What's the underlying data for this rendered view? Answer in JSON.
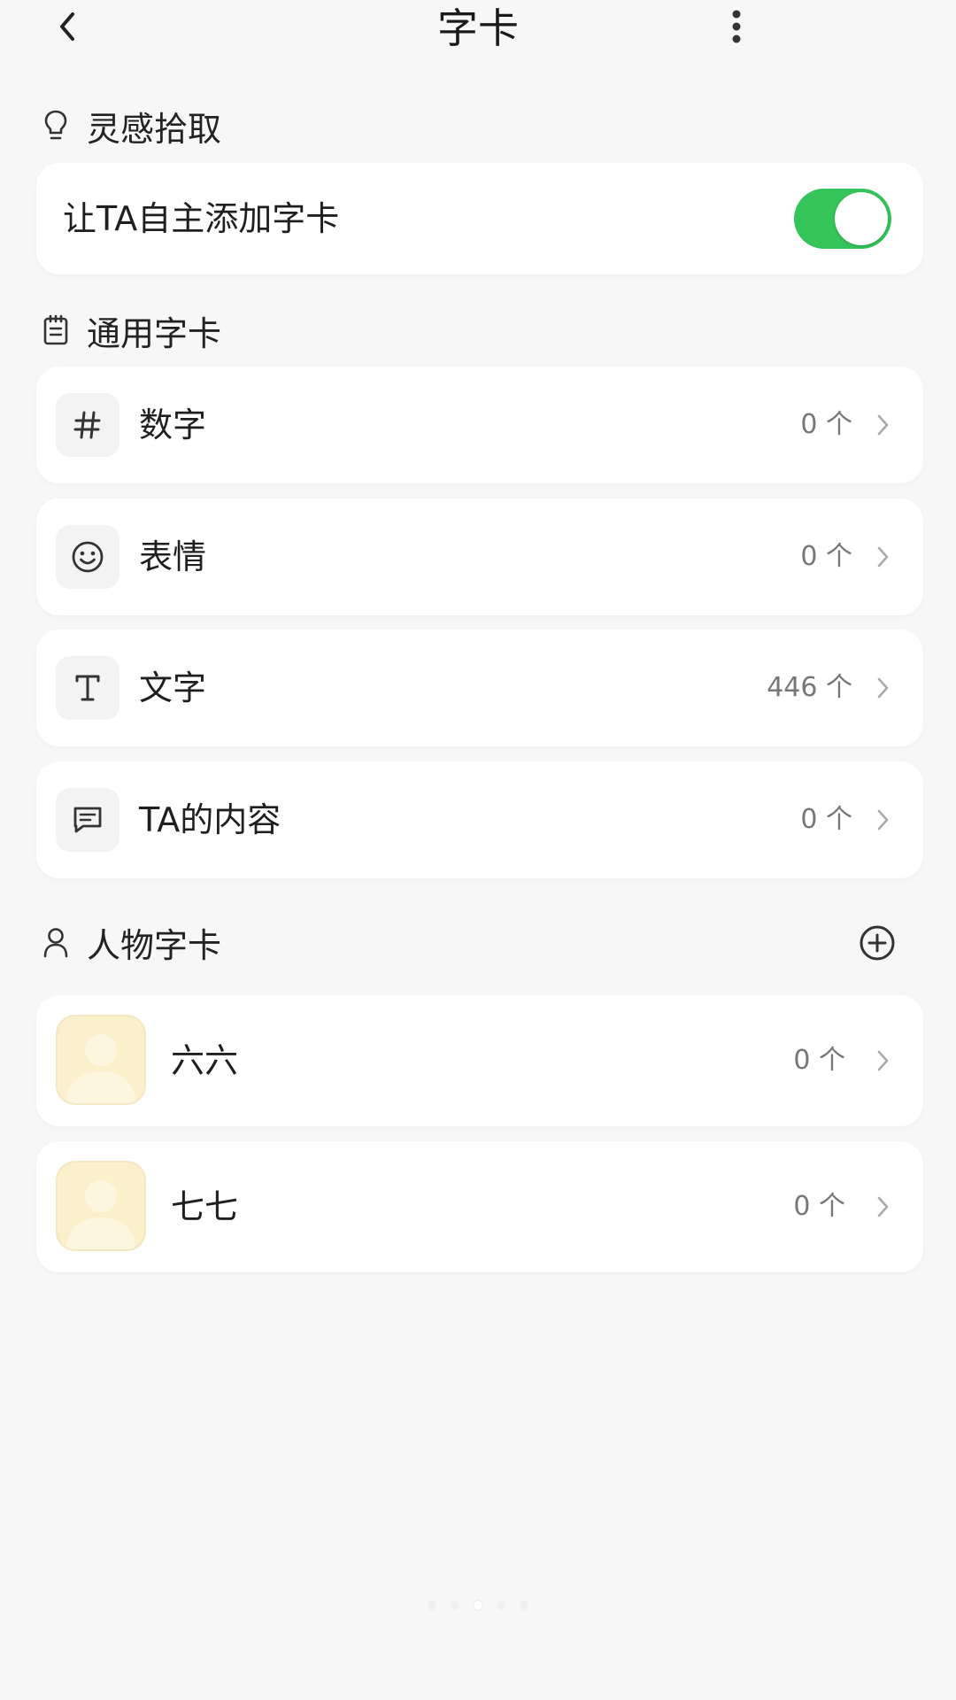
{
  "header": {
    "title": "字卡",
    "back_icon": "chevron-left-icon",
    "more_icon": "more-vertical-icon"
  },
  "inspiration": {
    "section_label": "灵感拾取",
    "icon": "lightbulb-icon",
    "toggle_label": "让TA自主添加字卡",
    "toggle_on": true,
    "toggle_color": "#34c459"
  },
  "general": {
    "section_label": "通用字卡",
    "icon": "clipboard-icon",
    "items": [
      {
        "label": "数字",
        "count": "0 个",
        "icon": "hash-icon"
      },
      {
        "label": "表情",
        "count": "0 个",
        "icon": "smiley-icon"
      },
      {
        "label": "文字",
        "count": "446 个",
        "icon": "text-icon"
      },
      {
        "label": "TA的内容",
        "count": "0 个",
        "icon": "chat-icon"
      }
    ]
  },
  "people": {
    "section_label": "人物字卡",
    "icon": "person-icon",
    "add_icon": "plus-circle-icon",
    "items": [
      {
        "name": "六六",
        "count": "0 个"
      },
      {
        "name": "七七",
        "count": "0 个"
      }
    ]
  }
}
